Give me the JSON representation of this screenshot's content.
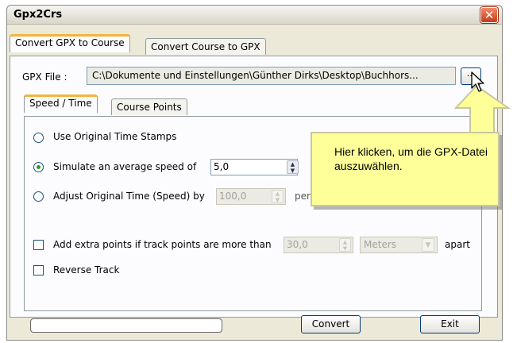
{
  "window": {
    "title": "Gpx2Crs",
    "close_label": "✕"
  },
  "tabs": [
    {
      "label": "Convert GPX to Course",
      "active": true
    },
    {
      "label": "Convert Course to GPX",
      "active": false
    }
  ],
  "gpx_file": {
    "label": "GPX File :",
    "path": "C:\\Dokumente und Einstellungen\\Günther Dirks\\Desktop\\Buchhors...",
    "browse_label": "..."
  },
  "inner_tabs": [
    {
      "label": "Speed / Time",
      "active": true
    },
    {
      "label": "Course Points",
      "active": false
    }
  ],
  "options": {
    "use_original": {
      "label": "Use Original Time Stamps",
      "selected": false
    },
    "simulate": {
      "label": "Simulate an average speed of",
      "value": "5,0",
      "selected": true
    },
    "adjust": {
      "label": "Adjust Original Time (Speed) by",
      "value": "100,0",
      "suffix": "perc",
      "selected": false
    },
    "extra_points": {
      "label": "Add extra points if track points are more than",
      "value": "30,0",
      "unit": "Meters",
      "suffix": "apart",
      "checked": false
    },
    "reverse": {
      "label": "Reverse Track",
      "checked": false
    }
  },
  "buttons": {
    "convert": "Convert",
    "exit": "Exit"
  },
  "callout": {
    "text": "Hier klicken, um die GPX-Datei auszuwählen."
  },
  "colors": {
    "callout_bg": "#ffff99",
    "tab_accent": "#f5b33b",
    "close_red": "#c83a16"
  }
}
